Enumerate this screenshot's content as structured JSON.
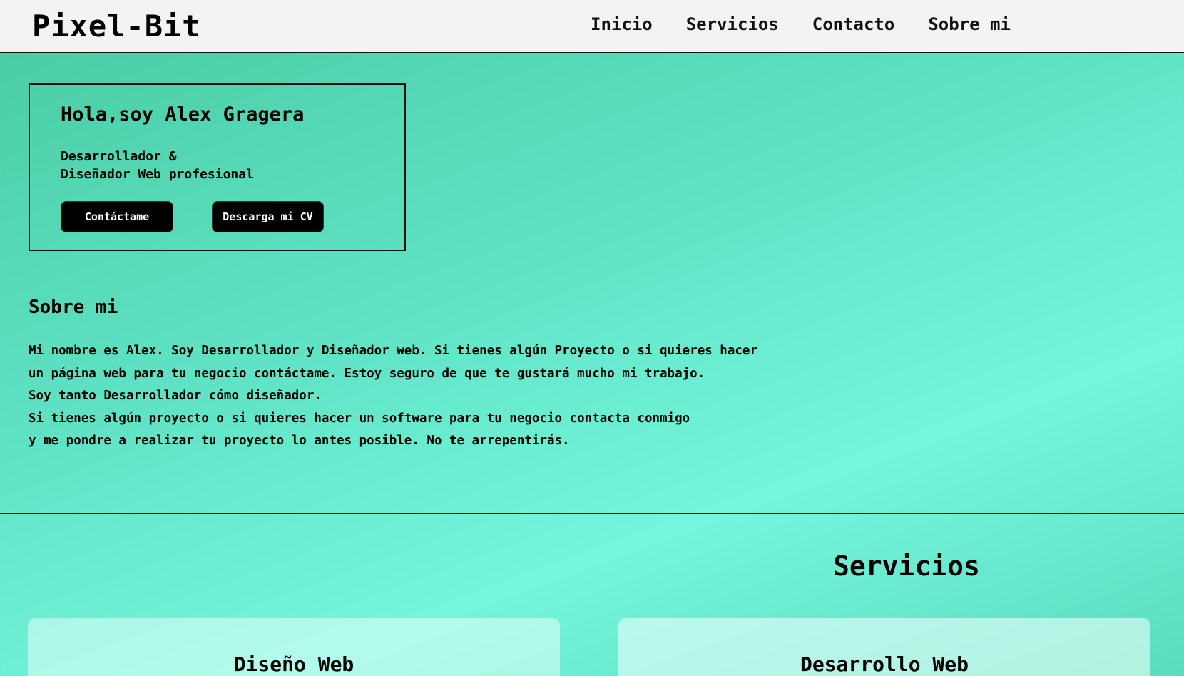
{
  "header": {
    "logo": "Pixel-Bit",
    "nav": [
      {
        "label": "Inicio"
      },
      {
        "label": "Servicios"
      },
      {
        "label": "Contacto"
      },
      {
        "label": "Sobre mi"
      }
    ]
  },
  "hero": {
    "title": "Hola,soy Alex Gragera",
    "subtitle_line1": "Desarrollador &",
    "subtitle_line2": "Diseñador Web profesional",
    "contact_button": "Contáctame",
    "cv_button": "Descarga mi CV"
  },
  "about": {
    "title": "Sobre mi",
    "lines": [
      "Mi nombre es Alex. Soy Desarrollador y Diseñador web. Si tienes algún Proyecto o si quieres hacer",
      "un página web para tu negocio contáctame. Estoy seguro de que te gustará mucho mi trabajo.",
      "Soy tanto Desarrollador cómo diseñador.",
      "Si tienes algún proyecto o si quieres hacer un software para tu negocio contacta conmigo",
      "y me pondre a realizar tu proyecto lo antes posible. No te arrepentirás."
    ]
  },
  "services": {
    "title": "Servicios",
    "cards": [
      {
        "title": "Diseño Web"
      },
      {
        "title": "Desarrollo Web"
      }
    ]
  },
  "colors": {
    "nav_background": "#f3f3f3",
    "gradient_start": "#48cba1",
    "gradient_mid": "#74f6dd",
    "button_background": "#000000",
    "button_text": "#ffffff"
  }
}
